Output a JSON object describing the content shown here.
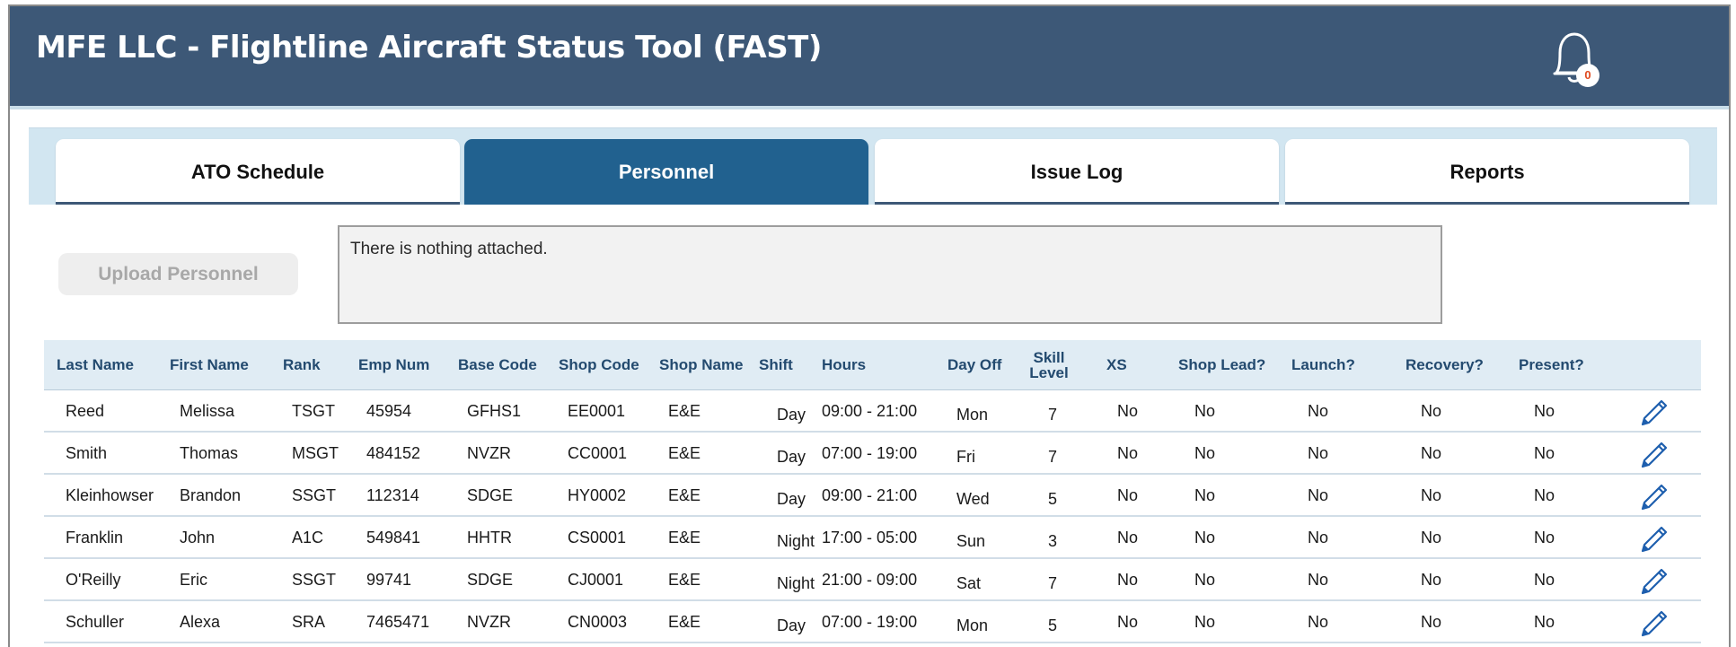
{
  "app": {
    "title": "MFE LLC - Flightline Aircraft Status Tool (FAST)",
    "notification_count": "0"
  },
  "tabs": [
    {
      "label": "ATO Schedule",
      "active": false
    },
    {
      "label": "Personnel",
      "active": true
    },
    {
      "label": "Issue Log",
      "active": false
    },
    {
      "label": "Reports",
      "active": false
    }
  ],
  "upload": {
    "button_label": "Upload Personnel",
    "attachment_text": "There is nothing attached."
  },
  "table": {
    "columns": [
      "Last Name",
      "First Name",
      "Rank",
      "Emp Num",
      "Base Code",
      "Shop Code",
      "Shop Name",
      "Shift",
      "Hours",
      "Day Off",
      "Skill Level",
      "XS",
      "Shop Lead?",
      "Launch?",
      "Recovery?",
      "Present?"
    ],
    "rows": [
      [
        "Reed",
        "Melissa",
        "TSGT",
        "45954",
        "GFHS1",
        "EE0001",
        "E&E",
        "Day",
        "09:00 - 21:00",
        "Mon",
        "7",
        "No",
        "No",
        "No",
        "No",
        "No"
      ],
      [
        "Smith",
        "Thomas",
        "MSGT",
        "484152",
        "NVZR",
        "CC0001",
        "E&E",
        "Day",
        "07:00 - 19:00",
        "Fri",
        "7",
        "No",
        "No",
        "No",
        "No",
        "No"
      ],
      [
        "Kleinhowser",
        "Brandon",
        "SSGT",
        "112314",
        "SDGE",
        "HY0002",
        "E&E",
        "Day",
        "09:00 - 21:00",
        "Wed",
        "5",
        "No",
        "No",
        "No",
        "No",
        "No"
      ],
      [
        "Franklin",
        "John",
        "A1C",
        "549841",
        "HHTR",
        "CS0001",
        "E&E",
        "Night",
        "17:00 - 05:00",
        "Sun",
        "3",
        "No",
        "No",
        "No",
        "No",
        "No"
      ],
      [
        "O'Reilly",
        "Eric",
        "SSGT",
        "99741",
        "SDGE",
        "CJ0001",
        "E&E",
        "Night",
        "21:00 - 09:00",
        "Sat",
        "7",
        "No",
        "No",
        "No",
        "No",
        "No"
      ],
      [
        "Schuller",
        "Alexa",
        "SRA",
        "7465471",
        "NVZR",
        "CN0003",
        "E&E",
        "Day",
        "07:00 - 19:00",
        "Mon",
        "5",
        "No",
        "No",
        "No",
        "No",
        "No"
      ]
    ]
  },
  "icons": {
    "notification": "bell-icon",
    "edit": "pencil-icon"
  },
  "colors": {
    "header_bg": "#3d5877",
    "active_tab_bg": "#21618f",
    "table_header_text": "#234a6f",
    "edit_icon": "#1e5fae"
  }
}
